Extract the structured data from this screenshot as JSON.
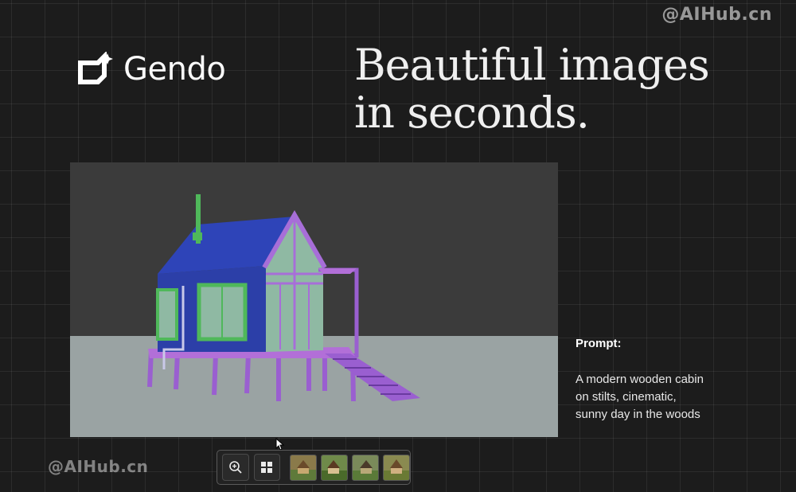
{
  "watermark": "@AIHub.cn",
  "brand": {
    "name": "Gendo"
  },
  "headline": {
    "line1": "Beautiful images",
    "line2": "in seconds."
  },
  "prompt": {
    "label": "Prompt:",
    "line1": "A modern wooden cabin",
    "line2": "on stilts, cinematic,",
    "line3": "sunny day in the woods"
  },
  "toolbar": {
    "icons": [
      "zoom-in-icon",
      "grid-view-icon"
    ],
    "thumbnails": 4
  },
  "colors": {
    "background": "#1c1c1c",
    "viewport_sky": "#3b3b3b",
    "viewport_ground": "#9aa3a3",
    "cabin_roof": "#2c3fa8",
    "cabin_trim": "#9a5fd0",
    "window_frame": "#4fb85a",
    "glass": "#8fb9a3"
  }
}
